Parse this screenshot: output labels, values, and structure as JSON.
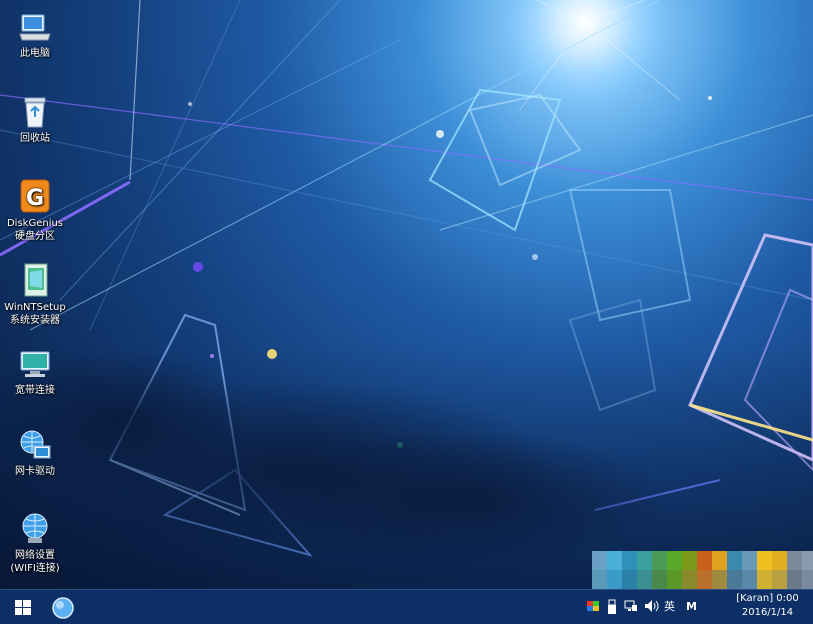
{
  "desktop": {
    "icons": [
      {
        "label": "此电脑",
        "icon": "this-pc-icon"
      },
      {
        "label": "回收站",
        "icon": "recycle-bin-icon"
      },
      {
        "label": "DiskGenius",
        "label2": "硬盘分区",
        "icon": "diskgenius-icon"
      },
      {
        "label": "WinNTSetup",
        "label2": "系统安装器",
        "icon": "winntsetup-icon"
      },
      {
        "label": "宽带连接",
        "icon": "broadband-icon"
      },
      {
        "label": "网卡驱动",
        "icon": "network-driver-icon"
      },
      {
        "label": "网络设置",
        "label2": "(WIFI连接)",
        "icon": "network-settings-icon"
      }
    ]
  },
  "taskbar": {
    "start_icon": "windows-logo-icon",
    "pinned_icon": "browser-globe-icon",
    "tray": {
      "ime_label": "英",
      "m_label": "M"
    },
    "clock": {
      "time": "[Karan]  0:00",
      "date": "2016/1/14"
    }
  },
  "colors": {
    "taskbar": "#0d2f66",
    "accent": "#3d8fd8"
  }
}
